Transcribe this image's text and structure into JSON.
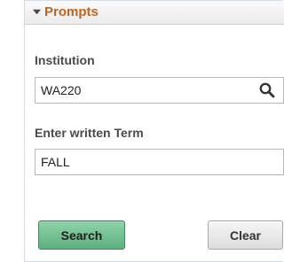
{
  "prompts": {
    "title": "Prompts",
    "institution": {
      "label": "Institution",
      "value": "WA220"
    },
    "term": {
      "label": "Enter written Term",
      "value": "FALL"
    },
    "buttons": {
      "search_label": "Search",
      "clear_label": "Clear"
    }
  },
  "icons": {
    "collapse": "triangle-down-icon",
    "lookup": "search-icon"
  },
  "colors": {
    "header_title": "#c0651f",
    "search_button": "#6cbf8b",
    "clear_button": "#e8e8e8"
  }
}
